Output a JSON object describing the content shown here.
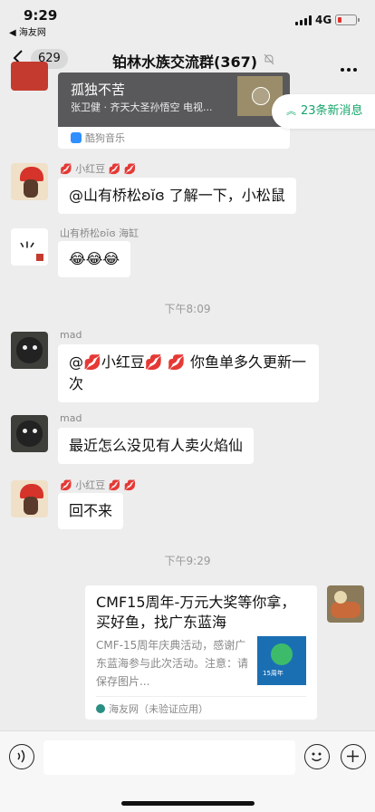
{
  "status_bar": {
    "time": "9:29",
    "back_app": "◀ 海友网",
    "network": "4G",
    "battery_color": "#e0312c"
  },
  "nav": {
    "unread_count": "629",
    "title": "铂林水族交流群(367)"
  },
  "new_messages_badge": "23条新消息",
  "messages": {
    "music": {
      "title": "孤独不苦",
      "subtitle": "张卫健 · 齐天大圣孙悟空 电视...",
      "source": "酷狗音乐"
    },
    "m1": {
      "sender": "💋 小红豆 💋 💋",
      "text": "@山有桥松ʚĭɞ 了解一下，小松鼠"
    },
    "m2": {
      "sender": "山有桥松ʚĭɞ 海缸",
      "text": "😂😂😂"
    },
    "time1": "下午8:09",
    "m3": {
      "sender": "mad",
      "text": "@💋小红豆💋 💋 你鱼单多久更新一次"
    },
    "m4": {
      "sender": "mad",
      "text": "最近怎么没见有人卖火焰仙"
    },
    "m5": {
      "sender": "💋 小红豆 💋 💋",
      "text": "回不来"
    },
    "time2": "下午9:29",
    "link_card": {
      "title": "CMF15周年-万元大奖等你拿，买好鱼，找广东蓝海",
      "description": "CMF-15周年庆典活动，感谢广东蓝海参与此次活动。注意：请保存图片...",
      "thumb_text": "15周年",
      "source": "海友网（未验证应用）"
    }
  },
  "colors": {
    "background": "#ededed",
    "accent_green": "#15a66a",
    "bubble": "#ffffff"
  }
}
